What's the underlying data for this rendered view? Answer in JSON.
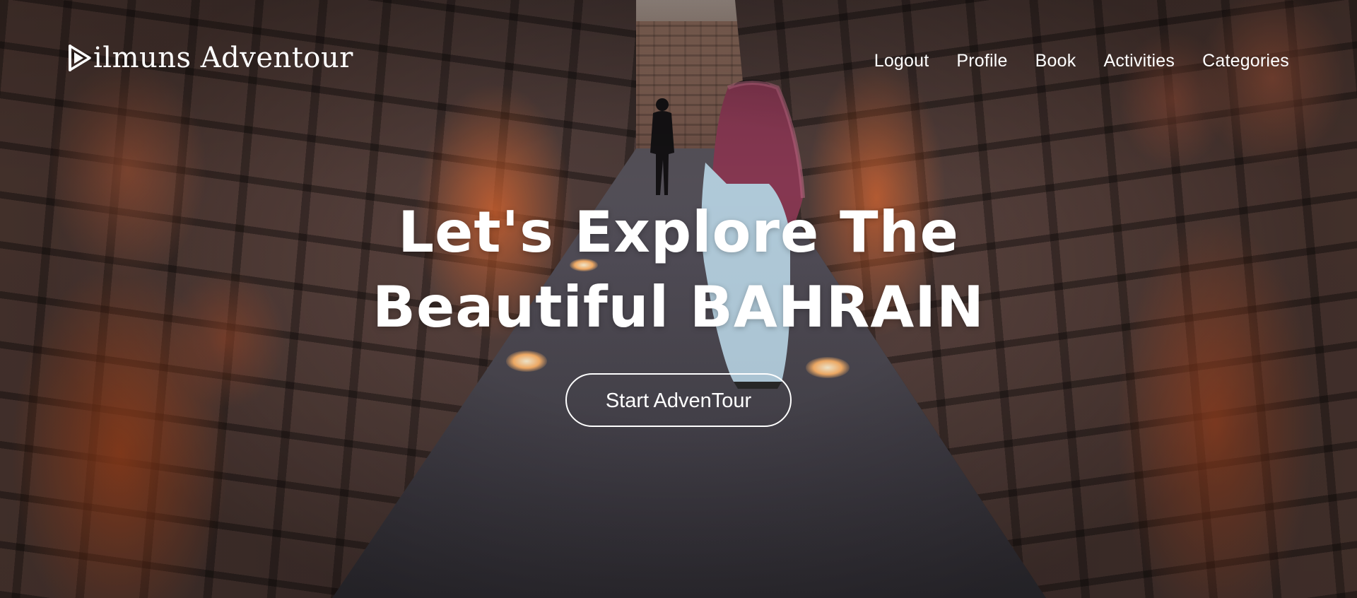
{
  "brand": {
    "name": "ilmuns Adventour",
    "icon": "play-triangle-d-icon"
  },
  "nav": {
    "items": [
      {
        "label": "Logout"
      },
      {
        "label": "Profile"
      },
      {
        "label": "Book"
      },
      {
        "label": "Activities"
      },
      {
        "label": "Categories"
      }
    ]
  },
  "hero": {
    "title_line1": "Let's Explore The",
    "title_line2": "Beautiful BAHRAIN",
    "cta_label": "Start AdvenTour"
  },
  "colors": {
    "text": "#ffffff",
    "accent_glow": "#e86c32",
    "stone_dark": "#3a302f"
  }
}
